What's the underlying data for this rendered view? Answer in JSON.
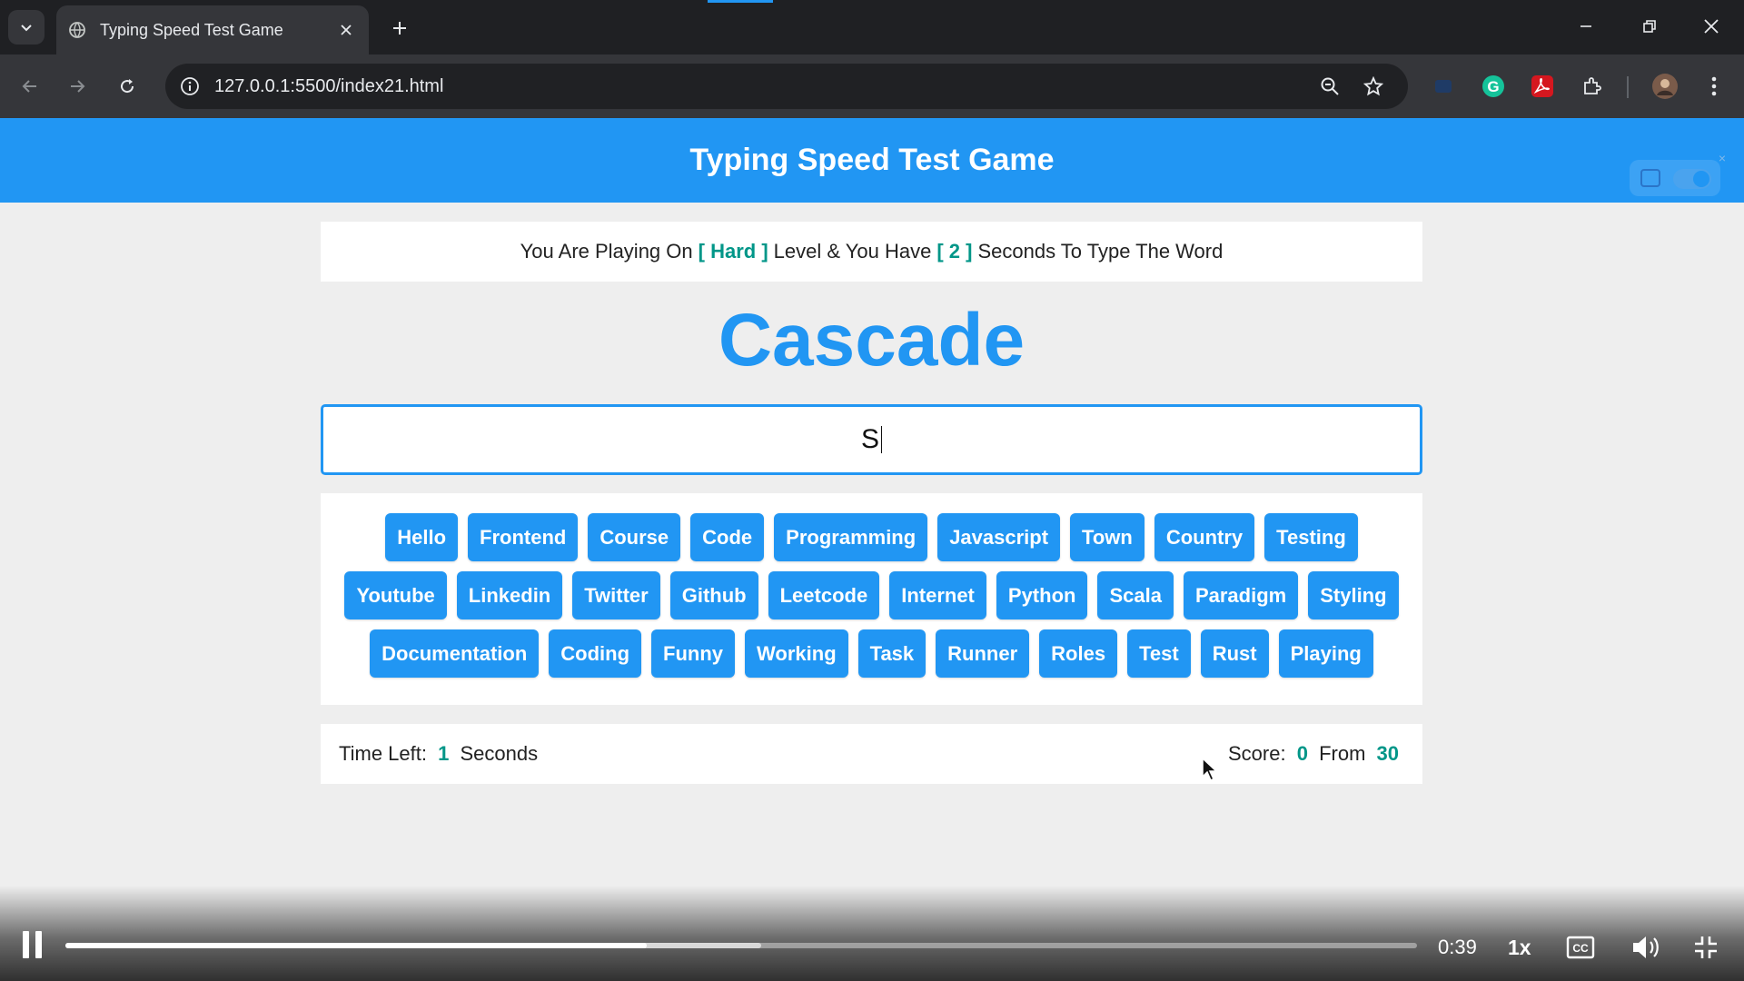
{
  "browser": {
    "tab_title": "Typing Speed Test Game",
    "url": "127.0.0.1:5500/index21.html"
  },
  "page": {
    "header_title": "Typing Speed Test Game",
    "message": {
      "prefix": "You Are Playing On",
      "level": "[ Hard ]",
      "middle": "Level & You Have",
      "seconds": "[ 2 ]",
      "suffix": "Seconds To Type The Word"
    },
    "current_word": "Cascade",
    "input_value": "S",
    "upcoming_words": [
      "Hello",
      "Frontend",
      "Course",
      "Code",
      "Programming",
      "Javascript",
      "Town",
      "Country",
      "Testing",
      "Youtube",
      "Linkedin",
      "Twitter",
      "Github",
      "Leetcode",
      "Internet",
      "Python",
      "Scala",
      "Paradigm",
      "Styling",
      "Documentation",
      "Coding",
      "Funny",
      "Working",
      "Task",
      "Runner",
      "Roles",
      "Test",
      "Rust",
      "Playing"
    ],
    "time_left_label": "Time Left:",
    "time_left_value": "1",
    "time_left_unit": "Seconds",
    "score_label": "Score:",
    "score_value": "0",
    "score_from_label": "From",
    "score_total": "30"
  },
  "player": {
    "time": "0:39",
    "speed": "1x",
    "progress": 0.43
  },
  "colors": {
    "accent": "#2196f3",
    "highlight": "#009688"
  }
}
